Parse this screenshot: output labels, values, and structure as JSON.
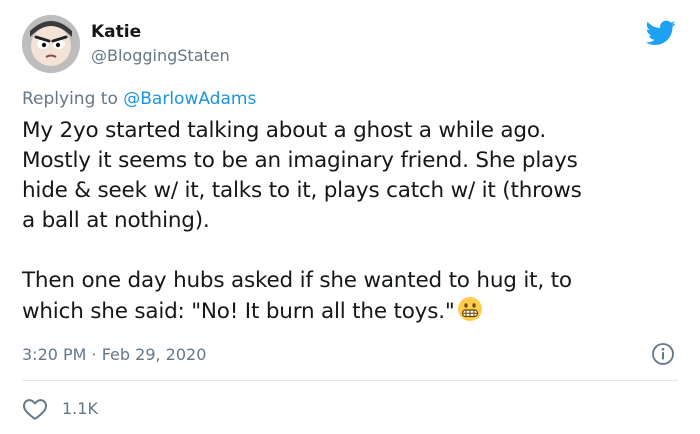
{
  "author": {
    "name": "Katie",
    "handle": "@BloggingStaten"
  },
  "reply": {
    "prefix": "Replying to ",
    "mention": "@BarlowAdams"
  },
  "tweet": {
    "lines_p1": [
      "My 2yo started talking about a ghost a while ago.",
      "Mostly it seems to be an imaginary friend. She plays",
      "hide & seek w/ it, talks to it, plays catch w/ it (throws",
      "a ball at nothing)."
    ],
    "lines_p2": [
      "Then one day hubs asked if she wanted to hug it, to",
      "which she said: \"No! It burn all the toys.\""
    ]
  },
  "meta": {
    "timestamp": "3:20 PM · Feb 29, 2020"
  },
  "engagement": {
    "likes": "1.1K"
  },
  "icons": {
    "brand": "twitter-bird-icon",
    "emoji": "grimacing-face-emoji",
    "info": "info-icon",
    "like": "heart-icon"
  },
  "colors": {
    "brand_blue": "#1da1f2",
    "link_blue": "#1b95e0",
    "secondary_text": "#657786"
  }
}
